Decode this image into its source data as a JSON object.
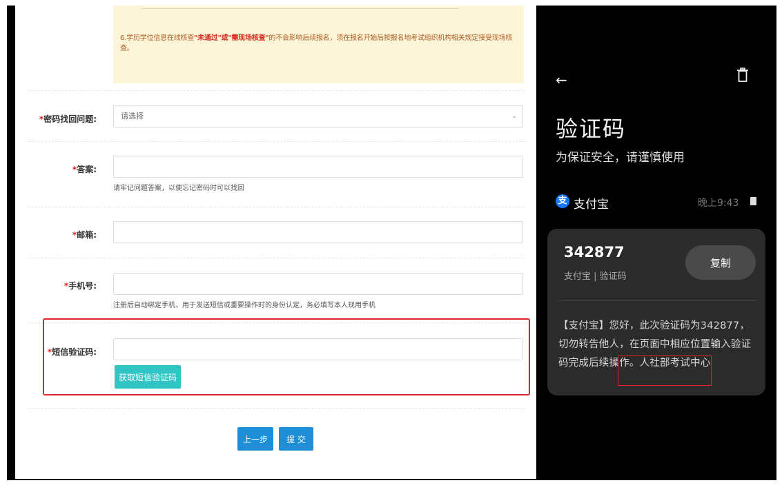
{
  "notice": {
    "prefix": "6.学历学位信息在线核查",
    "highlight": "\"未通过\"或\"需现场核查\"",
    "suffix": "的不会影响后续报名，须在报名开始后按报名地考试组织机构相关规定接受现场核查。"
  },
  "form": {
    "question": {
      "label": "密码找回问题:",
      "value": "请选择"
    },
    "answer": {
      "label": "答案:",
      "hint": "请牢记问题答案，以便忘记密码时可以找回"
    },
    "email": {
      "label": "邮箱:"
    },
    "phone": {
      "label": "手机号:",
      "hint": "注册后自动绑定手机，用于发送短信或重要操作时的身份认定，务必填写本人现用手机"
    },
    "sms": {
      "label": "短信验证码:",
      "button": "获取短信验证码"
    },
    "required_mark": "*",
    "prev_button": "上一步",
    "submit_button": "提 交"
  },
  "phone_panel": {
    "back_icon": "arrow-left-icon",
    "delete_icon": "trash-icon",
    "title": "验证码",
    "subtitle": "为保证安全，请谨慎使用",
    "sender": "支付宝",
    "sender_icon_glyph": "支",
    "time": "晚上9:43",
    "code": "342877",
    "code_meta": "支付宝 | 验证码",
    "copy_button": "复制",
    "message": "【支付宝】您好，此次验证码为342877，切勿转告他人，在页面中相应位置输入验证码完成后续操作。人社部考试中心"
  },
  "colors": {
    "highlight_border": "#e0242b",
    "sms_button": "#31c4c4",
    "primary_button": "#1e8ed6",
    "notice_bg": "#fcf5d7"
  }
}
